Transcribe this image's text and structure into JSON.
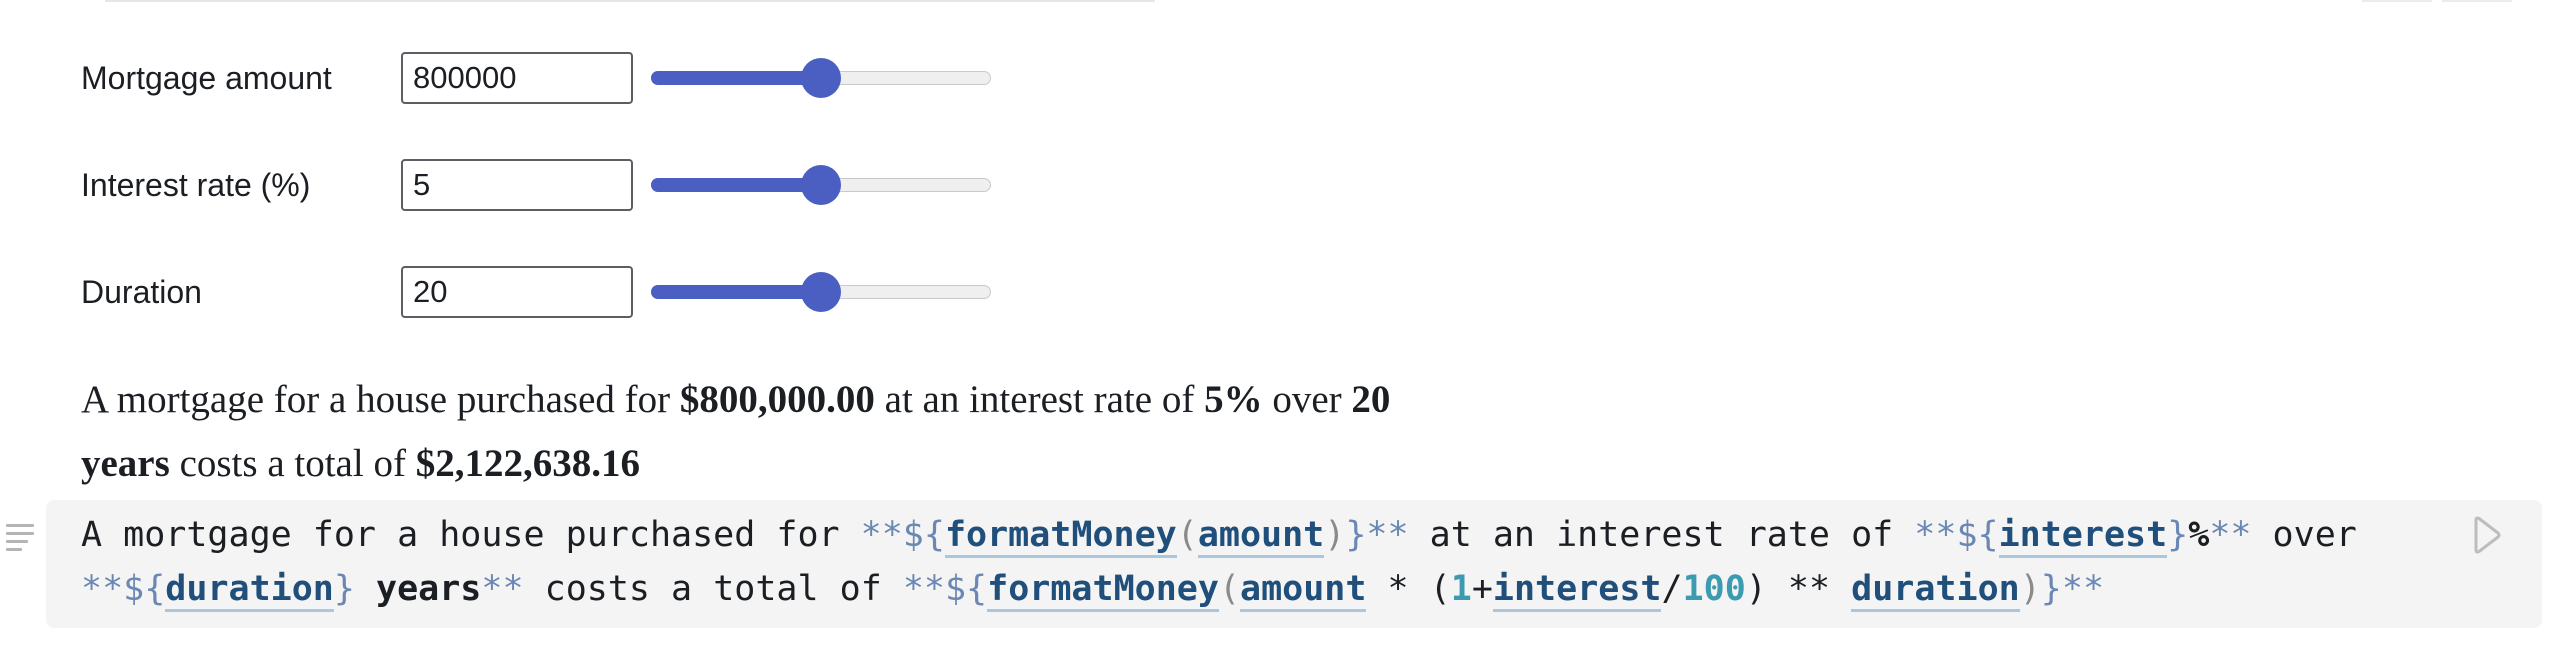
{
  "inputs": [
    {
      "label": "Mortgage amount",
      "value": "800000",
      "slider_fraction": 0.5
    },
    {
      "label": "Interest rate (%)",
      "value": "5",
      "slider_fraction": 0.5
    },
    {
      "label": "Duration",
      "value": "20",
      "slider_fraction": 0.5
    }
  ],
  "output": {
    "t1": "A mortgage for a house purchased for ",
    "amount": "$800,000.00",
    "t2": " at an interest rate of ",
    "rate": "5%",
    "t3": " over ",
    "years_num": "20",
    "years_word": "years",
    "t4": " costs a total of ",
    "total": "$2,122,638.16"
  },
  "code": {
    "seg_01": "A mortgage for a house purchased for ",
    "seg_02": "**${",
    "seg_03": "formatMoney",
    "seg_04": "(",
    "seg_05": "amount",
    "seg_06": ")",
    "seg_07": "}**",
    "seg_08": " at an interest rate of ",
    "seg_09": "**${",
    "seg_10": "interest",
    "seg_11": "}",
    "seg_12": "%",
    "seg_13": "**",
    "seg_14": " over",
    "seg_15": "**${",
    "seg_16": "duration",
    "seg_17": "}",
    "seg_18": " years",
    "seg_19": "**",
    "seg_20": " costs a total of ",
    "seg_21": "**${",
    "seg_22": "formatMoney",
    "seg_23": "(",
    "seg_24": "amount",
    "seg_25": " * (",
    "seg_26": "1",
    "seg_27": "+",
    "seg_28": "interest",
    "seg_29": "/",
    "seg_30": "100",
    "seg_31": ") ** ",
    "seg_32": "duration",
    "seg_33": ")",
    "seg_34": "}**"
  },
  "colors": {
    "slider_accent": "#4a5fc1",
    "markdown_marker": "#6b88b4",
    "identifier": "#1f4f7a",
    "number_literal": "#3c9bb0",
    "cell_background": "#f4f4f4"
  },
  "icons": {
    "cell_handle": "drag-handle-icon",
    "run": "run-cell-icon"
  }
}
